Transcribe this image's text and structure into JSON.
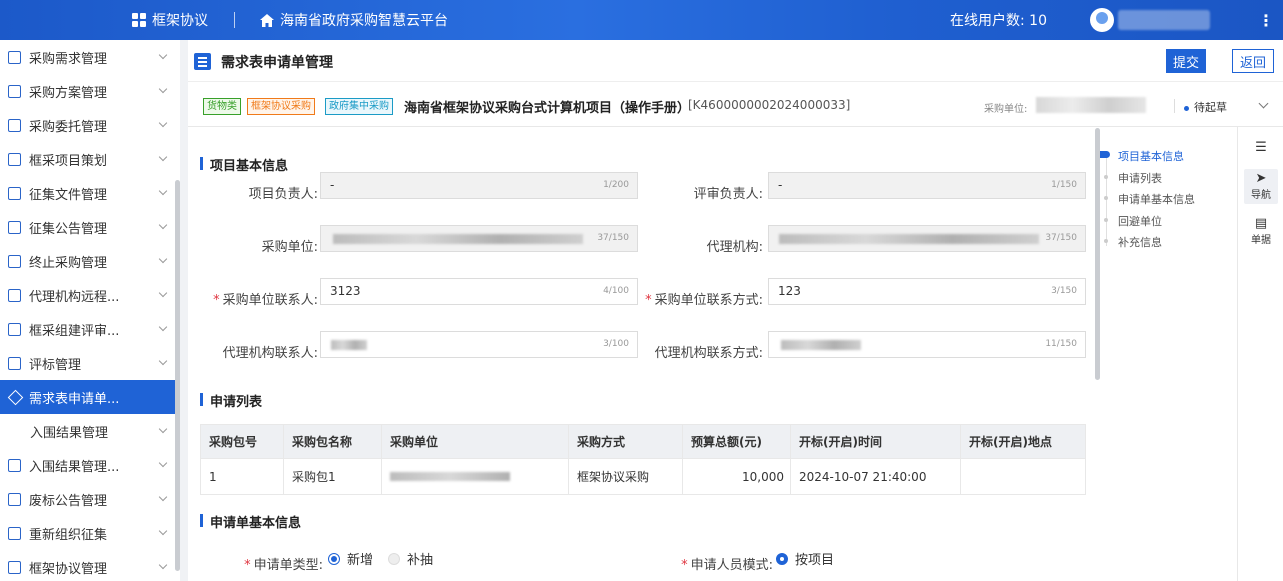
{
  "topbar": {
    "app_name": "框架协议",
    "platform_name": "海南省政府采购智慧云平台",
    "online_users": "在线用户数: 10",
    "more": "⋮"
  },
  "sidebar": {
    "items": [
      {
        "label": "采购需求管理"
      },
      {
        "label": "采购方案管理"
      },
      {
        "label": "采购委托管理"
      },
      {
        "label": "框采项目策划"
      },
      {
        "label": "征集文件管理"
      },
      {
        "label": "征集公告管理"
      },
      {
        "label": "终止采购管理"
      },
      {
        "label": "代理机构远程..."
      },
      {
        "label": "框采组建评审..."
      },
      {
        "label": "评标管理"
      },
      {
        "label": "需求表申请单..."
      },
      {
        "label": "入围结果管理"
      },
      {
        "label": "入围结果管理..."
      },
      {
        "label": "废标公告管理"
      },
      {
        "label": "重新组织征集"
      },
      {
        "label": "框架协议管理"
      }
    ]
  },
  "page": {
    "title": "需求表申请单管理",
    "submit_label": "提交",
    "back_label": "返回"
  },
  "project": {
    "tags": [
      "货物类",
      "框架协议采购",
      "政府集中采购"
    ],
    "name": "海南省框架协议采购台式计算机项目（操作手册）",
    "code": "[K4600000002024000033]",
    "unit_label": "采购单位:",
    "status": "待起草"
  },
  "basic_info": {
    "section_title": "项目基本信息",
    "fields": {
      "project_lead_label": "项目负责人:",
      "project_lead_value": "-",
      "project_lead_count": "1/200",
      "reviewer_label": "评审负责人:",
      "reviewer_value": "-",
      "reviewer_count": "1/150",
      "purchaser_label": "采购单位:",
      "purchaser_count": "37/150",
      "agency_label": "代理机构:",
      "agency_count": "37/150",
      "purchaser_contact_label": "采购单位联系人:",
      "purchaser_contact_value": "3123",
      "purchaser_contact_count": "4/100",
      "purchaser_phone_label": "采购单位联系方式:",
      "purchaser_phone_value": "123",
      "purchaser_phone_count": "3/150",
      "agency_contact_label": "代理机构联系人:",
      "agency_contact_count": "3/100",
      "agency_phone_label": "代理机构联系方式:",
      "agency_phone_count": "11/150"
    }
  },
  "apply_list": {
    "section_title": "申请列表",
    "columns": [
      "采购包号",
      "采购包名称",
      "采购单位",
      "采购方式",
      "预算总额(元)",
      "开标(开启)时间",
      "开标(开启)地点"
    ],
    "rows": [
      {
        "pkg_no": "1",
        "pkg_name": "采购包1",
        "method": "框架协议采购",
        "budget": "10,000",
        "open_time": "2024-10-07 21:40:00",
        "open_place": ""
      }
    ]
  },
  "apply_basic": {
    "section_title": "申请单基本信息",
    "type_label": "申请单类型:",
    "type_options": [
      "新增",
      "补抽"
    ],
    "mode_label": "申请人员模式:",
    "mode_options": [
      "按项目"
    ]
  },
  "anchor_nav": {
    "items": [
      "项目基本信息",
      "申请列表",
      "申请单基本信息",
      "回避单位",
      "补充信息"
    ]
  },
  "rightbar": {
    "nav_label": "导航",
    "doc_label": "单据"
  },
  "colors": {
    "primary": "#1f63d6",
    "required": "#e0343f"
  }
}
